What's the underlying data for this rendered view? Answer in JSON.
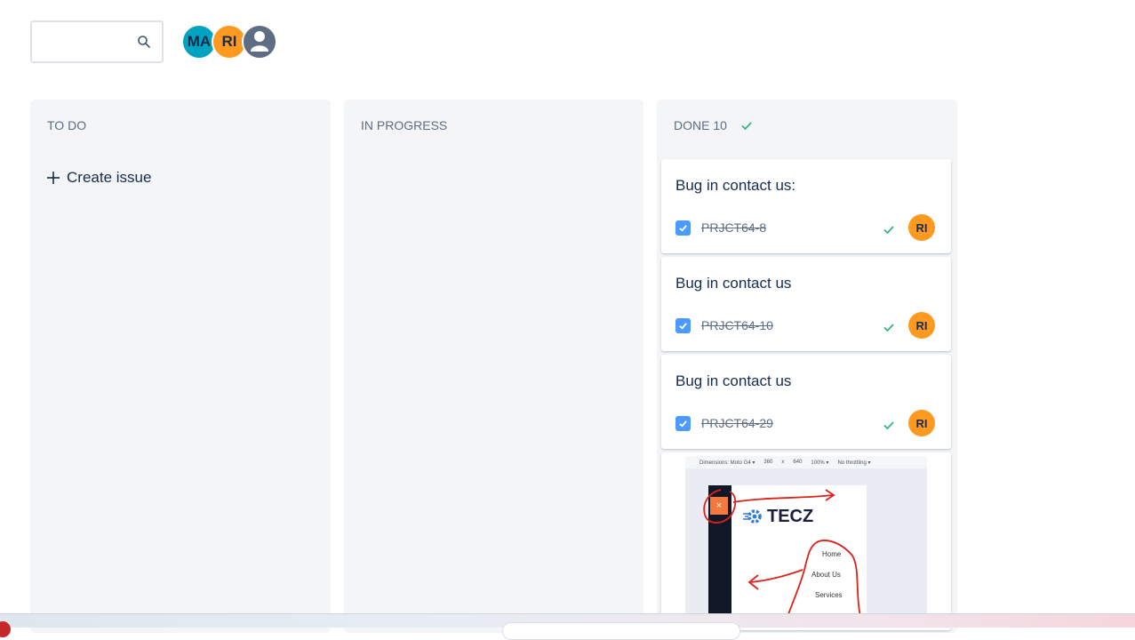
{
  "search": {
    "value": "",
    "placeholder": ""
  },
  "avatars": [
    "MA",
    "RI"
  ],
  "columns": {
    "todo": {
      "title": "TO DO",
      "create_label": "Create issue"
    },
    "progress": {
      "title": "IN PROGRESS"
    },
    "done": {
      "title": "DONE 10"
    }
  },
  "cards": [
    {
      "summary": "Bug in contact us:",
      "key": "PRJCT64-8",
      "assignee": "RI"
    },
    {
      "summary": "Bug in contact us",
      "key": "PRJCT64-10",
      "assignee": "RI"
    },
    {
      "summary": "Bug in contact us",
      "key": "PRJCT64-29",
      "assignee": "RI"
    }
  ],
  "attachment": {
    "device_bar": [
      "Dimensions: Moto G4 ▾",
      "360",
      "x",
      "640",
      "100% ▾",
      "No throttling ▾"
    ],
    "close_glyph": "×",
    "logo_text": "TECZ",
    "nav": [
      "Home",
      "About Us",
      "Services"
    ]
  },
  "colors": {
    "accent_blue": "#4c9aff",
    "done_green": "#36b37e",
    "avatar_orange": "#ff991f",
    "avatar_teal": "#00a3bf",
    "column_bg": "#f4f5f7"
  }
}
